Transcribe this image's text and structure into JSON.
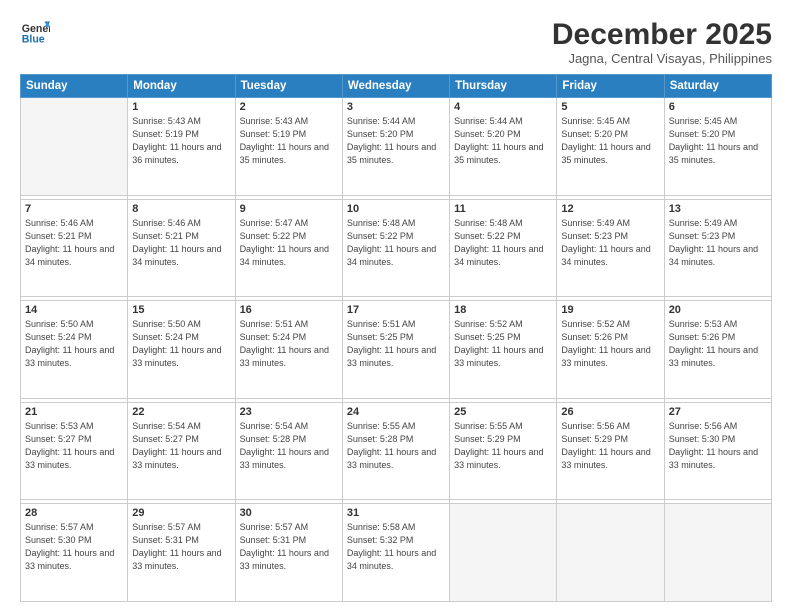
{
  "header": {
    "logo_line1": "General",
    "logo_line2": "Blue",
    "title": "December 2025",
    "subtitle": "Jagna, Central Visayas, Philippines"
  },
  "calendar": {
    "days_of_week": [
      "Sunday",
      "Monday",
      "Tuesday",
      "Wednesday",
      "Thursday",
      "Friday",
      "Saturday"
    ],
    "weeks": [
      [
        {
          "num": "",
          "sunrise": "",
          "sunset": "",
          "daylight": "",
          "empty": true
        },
        {
          "num": "1",
          "sunrise": "Sunrise: 5:43 AM",
          "sunset": "Sunset: 5:19 PM",
          "daylight": "Daylight: 11 hours and 36 minutes."
        },
        {
          "num": "2",
          "sunrise": "Sunrise: 5:43 AM",
          "sunset": "Sunset: 5:19 PM",
          "daylight": "Daylight: 11 hours and 35 minutes."
        },
        {
          "num": "3",
          "sunrise": "Sunrise: 5:44 AM",
          "sunset": "Sunset: 5:20 PM",
          "daylight": "Daylight: 11 hours and 35 minutes."
        },
        {
          "num": "4",
          "sunrise": "Sunrise: 5:44 AM",
          "sunset": "Sunset: 5:20 PM",
          "daylight": "Daylight: 11 hours and 35 minutes."
        },
        {
          "num": "5",
          "sunrise": "Sunrise: 5:45 AM",
          "sunset": "Sunset: 5:20 PM",
          "daylight": "Daylight: 11 hours and 35 minutes."
        },
        {
          "num": "6",
          "sunrise": "Sunrise: 5:45 AM",
          "sunset": "Sunset: 5:20 PM",
          "daylight": "Daylight: 11 hours and 35 minutes."
        }
      ],
      [
        {
          "num": "7",
          "sunrise": "Sunrise: 5:46 AM",
          "sunset": "Sunset: 5:21 PM",
          "daylight": "Daylight: 11 hours and 34 minutes."
        },
        {
          "num": "8",
          "sunrise": "Sunrise: 5:46 AM",
          "sunset": "Sunset: 5:21 PM",
          "daylight": "Daylight: 11 hours and 34 minutes."
        },
        {
          "num": "9",
          "sunrise": "Sunrise: 5:47 AM",
          "sunset": "Sunset: 5:22 PM",
          "daylight": "Daylight: 11 hours and 34 minutes."
        },
        {
          "num": "10",
          "sunrise": "Sunrise: 5:48 AM",
          "sunset": "Sunset: 5:22 PM",
          "daylight": "Daylight: 11 hours and 34 minutes."
        },
        {
          "num": "11",
          "sunrise": "Sunrise: 5:48 AM",
          "sunset": "Sunset: 5:22 PM",
          "daylight": "Daylight: 11 hours and 34 minutes."
        },
        {
          "num": "12",
          "sunrise": "Sunrise: 5:49 AM",
          "sunset": "Sunset: 5:23 PM",
          "daylight": "Daylight: 11 hours and 34 minutes."
        },
        {
          "num": "13",
          "sunrise": "Sunrise: 5:49 AM",
          "sunset": "Sunset: 5:23 PM",
          "daylight": "Daylight: 11 hours and 34 minutes."
        }
      ],
      [
        {
          "num": "14",
          "sunrise": "Sunrise: 5:50 AM",
          "sunset": "Sunset: 5:24 PM",
          "daylight": "Daylight: 11 hours and 33 minutes."
        },
        {
          "num": "15",
          "sunrise": "Sunrise: 5:50 AM",
          "sunset": "Sunset: 5:24 PM",
          "daylight": "Daylight: 11 hours and 33 minutes."
        },
        {
          "num": "16",
          "sunrise": "Sunrise: 5:51 AM",
          "sunset": "Sunset: 5:24 PM",
          "daylight": "Daylight: 11 hours and 33 minutes."
        },
        {
          "num": "17",
          "sunrise": "Sunrise: 5:51 AM",
          "sunset": "Sunset: 5:25 PM",
          "daylight": "Daylight: 11 hours and 33 minutes."
        },
        {
          "num": "18",
          "sunrise": "Sunrise: 5:52 AM",
          "sunset": "Sunset: 5:25 PM",
          "daylight": "Daylight: 11 hours and 33 minutes."
        },
        {
          "num": "19",
          "sunrise": "Sunrise: 5:52 AM",
          "sunset": "Sunset: 5:26 PM",
          "daylight": "Daylight: 11 hours and 33 minutes."
        },
        {
          "num": "20",
          "sunrise": "Sunrise: 5:53 AM",
          "sunset": "Sunset: 5:26 PM",
          "daylight": "Daylight: 11 hours and 33 minutes."
        }
      ],
      [
        {
          "num": "21",
          "sunrise": "Sunrise: 5:53 AM",
          "sunset": "Sunset: 5:27 PM",
          "daylight": "Daylight: 11 hours and 33 minutes."
        },
        {
          "num": "22",
          "sunrise": "Sunrise: 5:54 AM",
          "sunset": "Sunset: 5:27 PM",
          "daylight": "Daylight: 11 hours and 33 minutes."
        },
        {
          "num": "23",
          "sunrise": "Sunrise: 5:54 AM",
          "sunset": "Sunset: 5:28 PM",
          "daylight": "Daylight: 11 hours and 33 minutes."
        },
        {
          "num": "24",
          "sunrise": "Sunrise: 5:55 AM",
          "sunset": "Sunset: 5:28 PM",
          "daylight": "Daylight: 11 hours and 33 minutes."
        },
        {
          "num": "25",
          "sunrise": "Sunrise: 5:55 AM",
          "sunset": "Sunset: 5:29 PM",
          "daylight": "Daylight: 11 hours and 33 minutes."
        },
        {
          "num": "26",
          "sunrise": "Sunrise: 5:56 AM",
          "sunset": "Sunset: 5:29 PM",
          "daylight": "Daylight: 11 hours and 33 minutes."
        },
        {
          "num": "27",
          "sunrise": "Sunrise: 5:56 AM",
          "sunset": "Sunset: 5:30 PM",
          "daylight": "Daylight: 11 hours and 33 minutes."
        }
      ],
      [
        {
          "num": "28",
          "sunrise": "Sunrise: 5:57 AM",
          "sunset": "Sunset: 5:30 PM",
          "daylight": "Daylight: 11 hours and 33 minutes."
        },
        {
          "num": "29",
          "sunrise": "Sunrise: 5:57 AM",
          "sunset": "Sunset: 5:31 PM",
          "daylight": "Daylight: 11 hours and 33 minutes."
        },
        {
          "num": "30",
          "sunrise": "Sunrise: 5:57 AM",
          "sunset": "Sunset: 5:31 PM",
          "daylight": "Daylight: 11 hours and 33 minutes."
        },
        {
          "num": "31",
          "sunrise": "Sunrise: 5:58 AM",
          "sunset": "Sunset: 5:32 PM",
          "daylight": "Daylight: 11 hours and 34 minutes."
        },
        {
          "num": "",
          "sunrise": "",
          "sunset": "",
          "daylight": "",
          "empty": true
        },
        {
          "num": "",
          "sunrise": "",
          "sunset": "",
          "daylight": "",
          "empty": true
        },
        {
          "num": "",
          "sunrise": "",
          "sunset": "",
          "daylight": "",
          "empty": true
        }
      ]
    ]
  }
}
